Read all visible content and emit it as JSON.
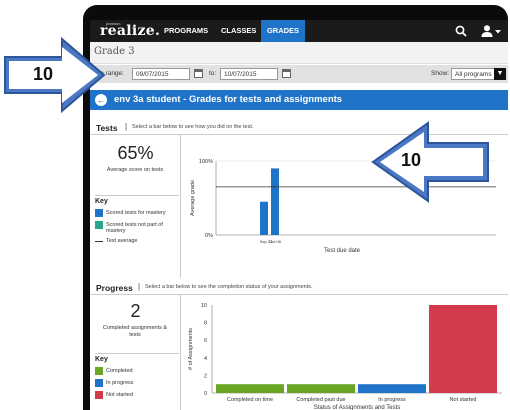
{
  "nav": {
    "brand_small": "pearson",
    "brand": "realize.",
    "links": [
      "PROGRAMS",
      "CLASSES",
      "GRADES"
    ]
  },
  "page": {
    "title": "Grade 3"
  },
  "filter": {
    "date_range_label": "Date range:",
    "from_value": "09/07/2015",
    "to_label": "to:",
    "to_value": "10/07/2015",
    "show_label": "Show:",
    "show_value": "All programs"
  },
  "student": {
    "title": "env 3a student - Grades for tests and assignments"
  },
  "tests": {
    "heading": "Tests",
    "separator": "|",
    "subtitle": "Select a bar below to see how you did on the test.",
    "stat": "65%",
    "stat_label": "Average score on tests",
    "key_title": "Key",
    "key": [
      {
        "label": "Scored tests for mastery",
        "color": "#1f73c9"
      },
      {
        "label": "Scored tests not part of mastery",
        "color": "#2aa58a"
      },
      {
        "label": "Test average"
      }
    ]
  },
  "progress": {
    "heading": "Progress",
    "separator": "|",
    "subtitle": "Select a bar below to see the completion status of your assignments.",
    "stat": "2",
    "stat_label": "Completed assignments & tests",
    "key_title": "Key",
    "key": [
      {
        "label": "Completed",
        "color": "#6aa624"
      },
      {
        "label": "In progress",
        "color": "#1f73c9"
      },
      {
        "label": "Not started",
        "color": "#d33a4a"
      }
    ]
  },
  "callouts": {
    "left": "10",
    "right": "10"
  },
  "colors": {
    "nav_bg": "#1b1b1b",
    "accent_blue": "#1f73c9",
    "callout_fill": "#4a78c4",
    "callout_stroke": "#2d5597"
  },
  "chart_data": [
    {
      "type": "bar",
      "categories": [
        "Sep 23",
        "Oct 08"
      ],
      "values": [
        45,
        90
      ],
      "average": 65,
      "ylim": [
        0,
        100
      ],
      "yticks": [
        "0%",
        "100%"
      ],
      "ylabel": "Average grade",
      "xlabel": "Test due date",
      "color": "#1f73c9"
    },
    {
      "type": "bar",
      "categories": [
        "Completed on time",
        "Completed past due",
        "In progress",
        "Not started"
      ],
      "values": [
        1,
        1,
        1,
        10
      ],
      "colors": [
        "#6aa624",
        "#6aa624",
        "#1f73c9",
        "#d33a4a"
      ],
      "ylim": [
        0,
        10
      ],
      "yticks": [
        "0",
        "2",
        "4",
        "6",
        "8",
        "10"
      ],
      "ylabel": "# of Assignments",
      "xlabel": "Status of Assignments and Tests"
    }
  ]
}
